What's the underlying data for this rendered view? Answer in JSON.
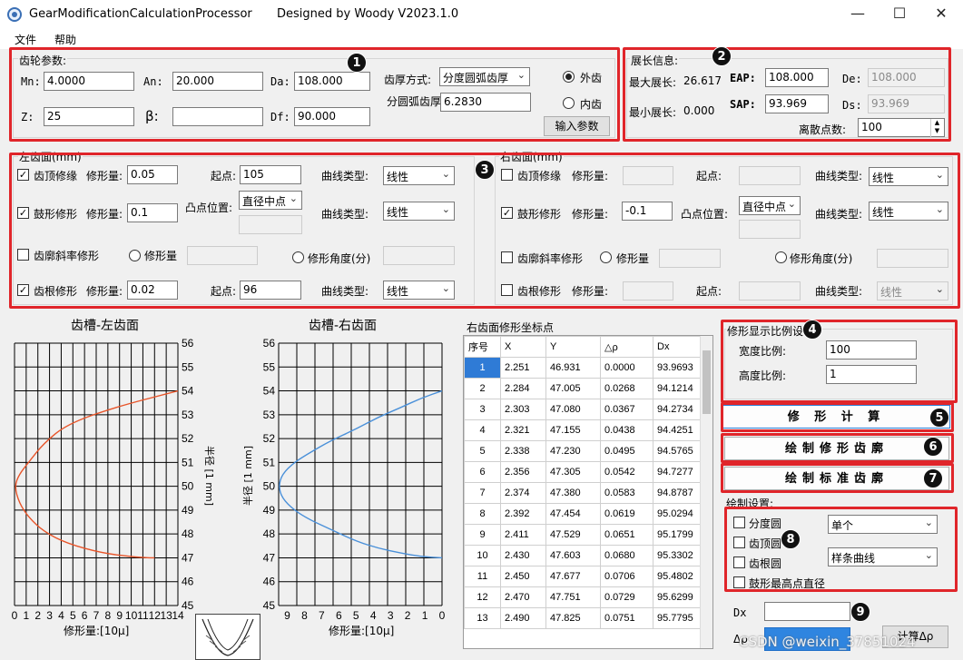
{
  "window": {
    "title": "GearModificationCalculationProcessor",
    "designer": "Designed by Woody  V2023.1.0",
    "minimize": "—",
    "maximize": "☐",
    "close": "✕"
  },
  "menu": [
    "文件",
    "帮助"
  ],
  "gear": {
    "group_label": "齿轮参数:",
    "mn_label": "Mn:",
    "mn": "4.0000",
    "an_label": "An:",
    "an": "20.000",
    "da_label": "Da:",
    "da": "108.000",
    "z_label": "Z:",
    "z": "25",
    "beta_label": "β:",
    "beta": "",
    "df_label": "Df:",
    "df": "90.000",
    "thickness_mode_label": "齿厚方式:",
    "thickness_mode": "分度圆弧齿厚",
    "arc_thickness_label": "分圆弧齿厚",
    "arc_thickness": "6.2830",
    "external_label": "外齿",
    "internal_label": "内齿",
    "input_button": "输入参数"
  },
  "span": {
    "group_label": "展长信息:",
    "max_label": "最大展长:",
    "max_value": "26.617",
    "min_label": "最小展长:",
    "min_value": "0.000",
    "eap_label": "EAP:",
    "eap": "108.000",
    "sap_label": "SAP:",
    "sap": "93.969",
    "de_label": "De:",
    "de": "108.000",
    "ds_label": "Ds:",
    "ds": "93.969",
    "points_label": "离散点数:",
    "points": "100"
  },
  "left_flank": {
    "group_label": "左齿面(mm)",
    "tip_label": "齿顶修缘",
    "tip_amount_label": "修形量:",
    "tip_amount": "0.05",
    "tip_start_label": "起点:",
    "tip_start": "105",
    "tip_curve_label": "曲线类型:",
    "tip_curve": "线性",
    "crown_label": "鼓形修形",
    "crown_amount_label": "修形量:",
    "crown_amount": "0.1",
    "crown_pos_label": "凸点位置:",
    "crown_pos": "直径中点",
    "crown_curve_label": "曲线类型:",
    "crown_curve": "线性",
    "slope_label": "齿廓斜率修形",
    "slope_amount_label": "修形量",
    "slope_angle_label": "修形角度(分)",
    "root_label": "齿根修形",
    "root_amount_label": "修形量:",
    "root_amount": "0.02",
    "root_start_label": "起点:",
    "root_start": "96",
    "root_curve_label": "曲线类型:",
    "root_curve": "线性"
  },
  "right_flank": {
    "group_label": "右齿面(mm)",
    "tip_label": "齿顶修缘",
    "tip_amount_label": "修形量:",
    "tip_start_label": "起点:",
    "tip_curve_label": "曲线类型:",
    "tip_curve": "线性",
    "crown_label": "鼓形修形",
    "crown_amount_label": "修形量:",
    "crown_amount": "-0.1",
    "crown_pos_label": "凸点位置:",
    "crown_pos": "直径中点",
    "crown_curve_label": "曲线类型:",
    "crown_curve": "线性",
    "slope_label": "齿廓斜率修形",
    "slope_amount_label": "修形量",
    "slope_angle_label": "修形角度(分)",
    "root_label": "齿根修形",
    "root_amount_label": "修形量:",
    "root_start_label": "起点:",
    "root_curve_label": "曲线类型:",
    "root_curve": "线性"
  },
  "charts_text": {
    "left_title": "齿槽-左齿面",
    "right_title": "齿槽-右齿面",
    "left_xlabel": "修形量:[10μ]",
    "right_xlabel": "修形量:[10μ]",
    "left_ylabel": "半径 [1 mm]",
    "right_ylabel": "半径 [1 mm]",
    "left_xticks": [
      "0",
      "1",
      "2",
      "3",
      "4",
      "5",
      "6",
      "7",
      "8",
      "9",
      "10",
      "11",
      "12",
      "13",
      "14"
    ],
    "right_xticks": [
      "9",
      "8",
      "7",
      "6",
      "5",
      "4",
      "3",
      "2",
      "1",
      "0"
    ],
    "yticks": [
      "56",
      "55",
      "54",
      "53",
      "52",
      "51",
      "50",
      "49",
      "48",
      "47",
      "46",
      "45"
    ],
    "left_color": "#e8552a",
    "right_color": "#4a90d9"
  },
  "chart_data": [
    {
      "type": "line",
      "title": "齿槽-左齿面",
      "xlabel": "修形量:[10μ]",
      "ylabel": "半径 [1 mm]",
      "xlim": [
        0,
        14
      ],
      "ylim": [
        45,
        56
      ],
      "series": [
        {
          "x": [
            14.0,
            8.5,
            4.5,
            2.5,
            1.2,
            0.4,
            0.0,
            0.4,
            1.2,
            2.5,
            4.5,
            7.5,
            10.0,
            11.5,
            12.0
          ],
          "y": [
            54.0,
            53.3,
            52.6,
            51.8,
            51.0,
            50.5,
            50.0,
            49.3,
            48.7,
            48.1,
            47.6,
            47.2,
            47.05,
            47.0,
            47.0
          ]
        }
      ]
    },
    {
      "type": "line",
      "title": "齿槽-右齿面",
      "xlabel": "修形量:[10μ]",
      "ylabel": "半径 [1 mm]",
      "xlim": [
        9.5,
        0
      ],
      "ylim": [
        45,
        56
      ],
      "series": [
        {
          "x": [
            0.0,
            1.2,
            2.4,
            3.7,
            5.0,
            6.5,
            7.7,
            8.6,
            9.3,
            9.5,
            9.3,
            8.6,
            7.7,
            6.5,
            5.0,
            3.7,
            2.4,
            1.2,
            0.0
          ],
          "y": [
            54.0,
            53.7,
            53.3,
            52.9,
            52.4,
            51.9,
            51.4,
            51.0,
            50.5,
            50.0,
            49.5,
            49.0,
            48.6,
            48.2,
            47.7,
            47.4,
            47.2,
            47.05,
            47.0
          ]
        }
      ]
    }
  ],
  "coord_table": {
    "title": "右齿面修形坐标点",
    "headers": [
      "序号",
      "X",
      "Y",
      "△ρ",
      "Dx"
    ],
    "rows": [
      [
        "1",
        "2.251",
        "46.931",
        "0.0000",
        "93.9693"
      ],
      [
        "2",
        "2.284",
        "47.005",
        "0.0268",
        "94.1214"
      ],
      [
        "3",
        "2.303",
        "47.080",
        "0.0367",
        "94.2734"
      ],
      [
        "4",
        "2.321",
        "47.155",
        "0.0438",
        "94.4251"
      ],
      [
        "5",
        "2.338",
        "47.230",
        "0.0495",
        "94.5765"
      ],
      [
        "6",
        "2.356",
        "47.305",
        "0.0542",
        "94.7277"
      ],
      [
        "7",
        "2.374",
        "47.380",
        "0.0583",
        "94.8787"
      ],
      [
        "8",
        "2.392",
        "47.454",
        "0.0619",
        "95.0294"
      ],
      [
        "9",
        "2.411",
        "47.529",
        "0.0651",
        "95.1799"
      ],
      [
        "10",
        "2.430",
        "47.603",
        "0.0680",
        "95.3302"
      ],
      [
        "11",
        "2.450",
        "47.677",
        "0.0706",
        "95.4802"
      ],
      [
        "12",
        "2.470",
        "47.751",
        "0.0729",
        "95.6299"
      ],
      [
        "13",
        "2.490",
        "47.825",
        "0.0751",
        "95.7795"
      ]
    ]
  },
  "scale": {
    "group_label": "修形显示比例设",
    "width_label": "宽度比例:",
    "width": "100",
    "height_label": "高度比例:",
    "height": "1"
  },
  "actions": {
    "calc": "修 形 计 算",
    "draw_mod": "绘制修形齿廓",
    "draw_std": "绘制标准齿廓"
  },
  "draw_settings": {
    "group_label": "绘制设置:",
    "pitch_circle": "分度圆",
    "tip_circle": "齿顶圆",
    "root_circle": "齿根圆",
    "crown_top": "鼓形最高点直径",
    "mode": "单个",
    "curve": "样条曲线"
  },
  "bottom": {
    "dx_label": "Dx",
    "drho_label": "Δρ",
    "calc_button": "计算Δρ",
    "watermark": "CSDN @weixin_37851024"
  },
  "badges": [
    "1",
    "2",
    "3",
    "4",
    "5",
    "6",
    "7",
    "8",
    "9"
  ]
}
